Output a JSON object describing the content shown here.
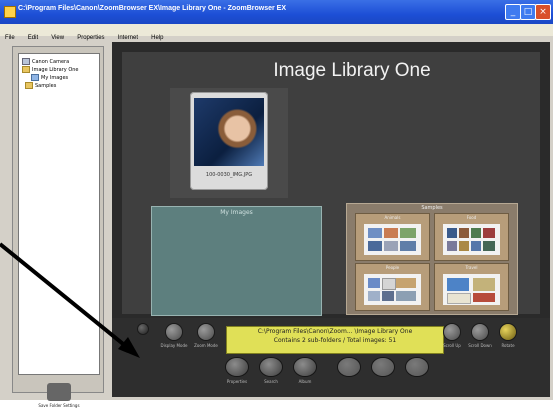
{
  "window": {
    "title": "C:\\Program Files\\Canon\\ZoomBrowser EX\\Image Library One - ZoomBrowser EX"
  },
  "menu": [
    "File",
    "Edit",
    "View",
    "Properties",
    "Internet",
    "Help"
  ],
  "tree": [
    {
      "label": "Canon Camera",
      "icon": "drive"
    },
    {
      "label": "Image Library One",
      "icon": "folder"
    },
    {
      "label": "My Images",
      "icon": "blue"
    },
    {
      "label": "Samples",
      "icon": "folder"
    }
  ],
  "left_panel": {
    "button_label": "Save Folder Settings"
  },
  "library": {
    "title": "Image Library One",
    "thumb_label": "100-0030_IMG.JPG",
    "folder_label": "My Images",
    "collection_label": "Samples",
    "sub_labels": [
      "Animals",
      "Food",
      "People",
      "Travel"
    ]
  },
  "info": {
    "line1": "C:\\Program Files\\Canon\\Zoom... \\Image Library One",
    "line2": "Contains 2 sub-folders / Total images: 51"
  },
  "controls": {
    "left": [
      "Display Mode",
      "Zoom Mode"
    ],
    "right": [
      "Scroll Up",
      "Scroll Down",
      "Rotate"
    ],
    "bottom": [
      "Properties",
      "Search",
      "Album",
      "",
      "",
      ""
    ]
  },
  "colors": {
    "accent": "#1d4fd6",
    "info_bg": "#e0e057"
  }
}
